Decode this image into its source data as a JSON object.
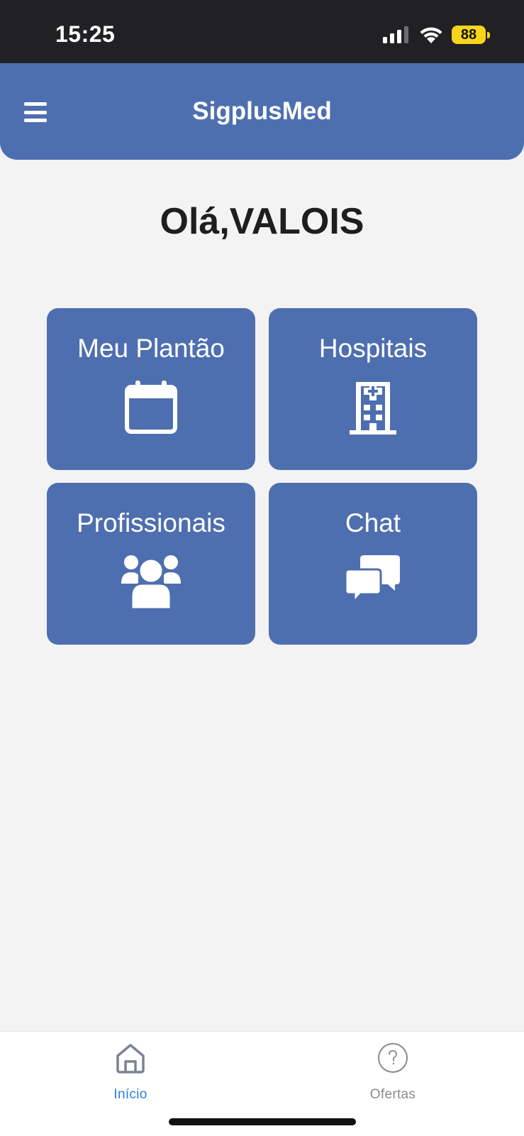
{
  "status_bar": {
    "time": "15:25",
    "battery_level": "88",
    "icons": [
      "signal-icon",
      "wifi-icon",
      "battery-icon"
    ],
    "battery_color": "#f6d51c"
  },
  "header": {
    "title": "SigplusMed",
    "menu_icon": "hamburger-menu-icon",
    "background_color": "#4e6faf"
  },
  "greeting": "Olá,VALOIS",
  "cards": [
    {
      "label": "Meu Plantão",
      "icon": "calendar-icon"
    },
    {
      "label": "Hospitais",
      "icon": "hospital-icon"
    },
    {
      "label": "Profissionais",
      "icon": "users-icon"
    },
    {
      "label": "Chat",
      "icon": "chat-icon"
    }
  ],
  "bottom_nav": {
    "items": [
      {
        "label": "Início",
        "icon": "home-icon",
        "active": true
      },
      {
        "label": "Ofertas",
        "icon": "help-circle-icon",
        "active": false
      }
    ],
    "active_color": "#2d7be5",
    "inactive_color": "#8a8a8a"
  }
}
